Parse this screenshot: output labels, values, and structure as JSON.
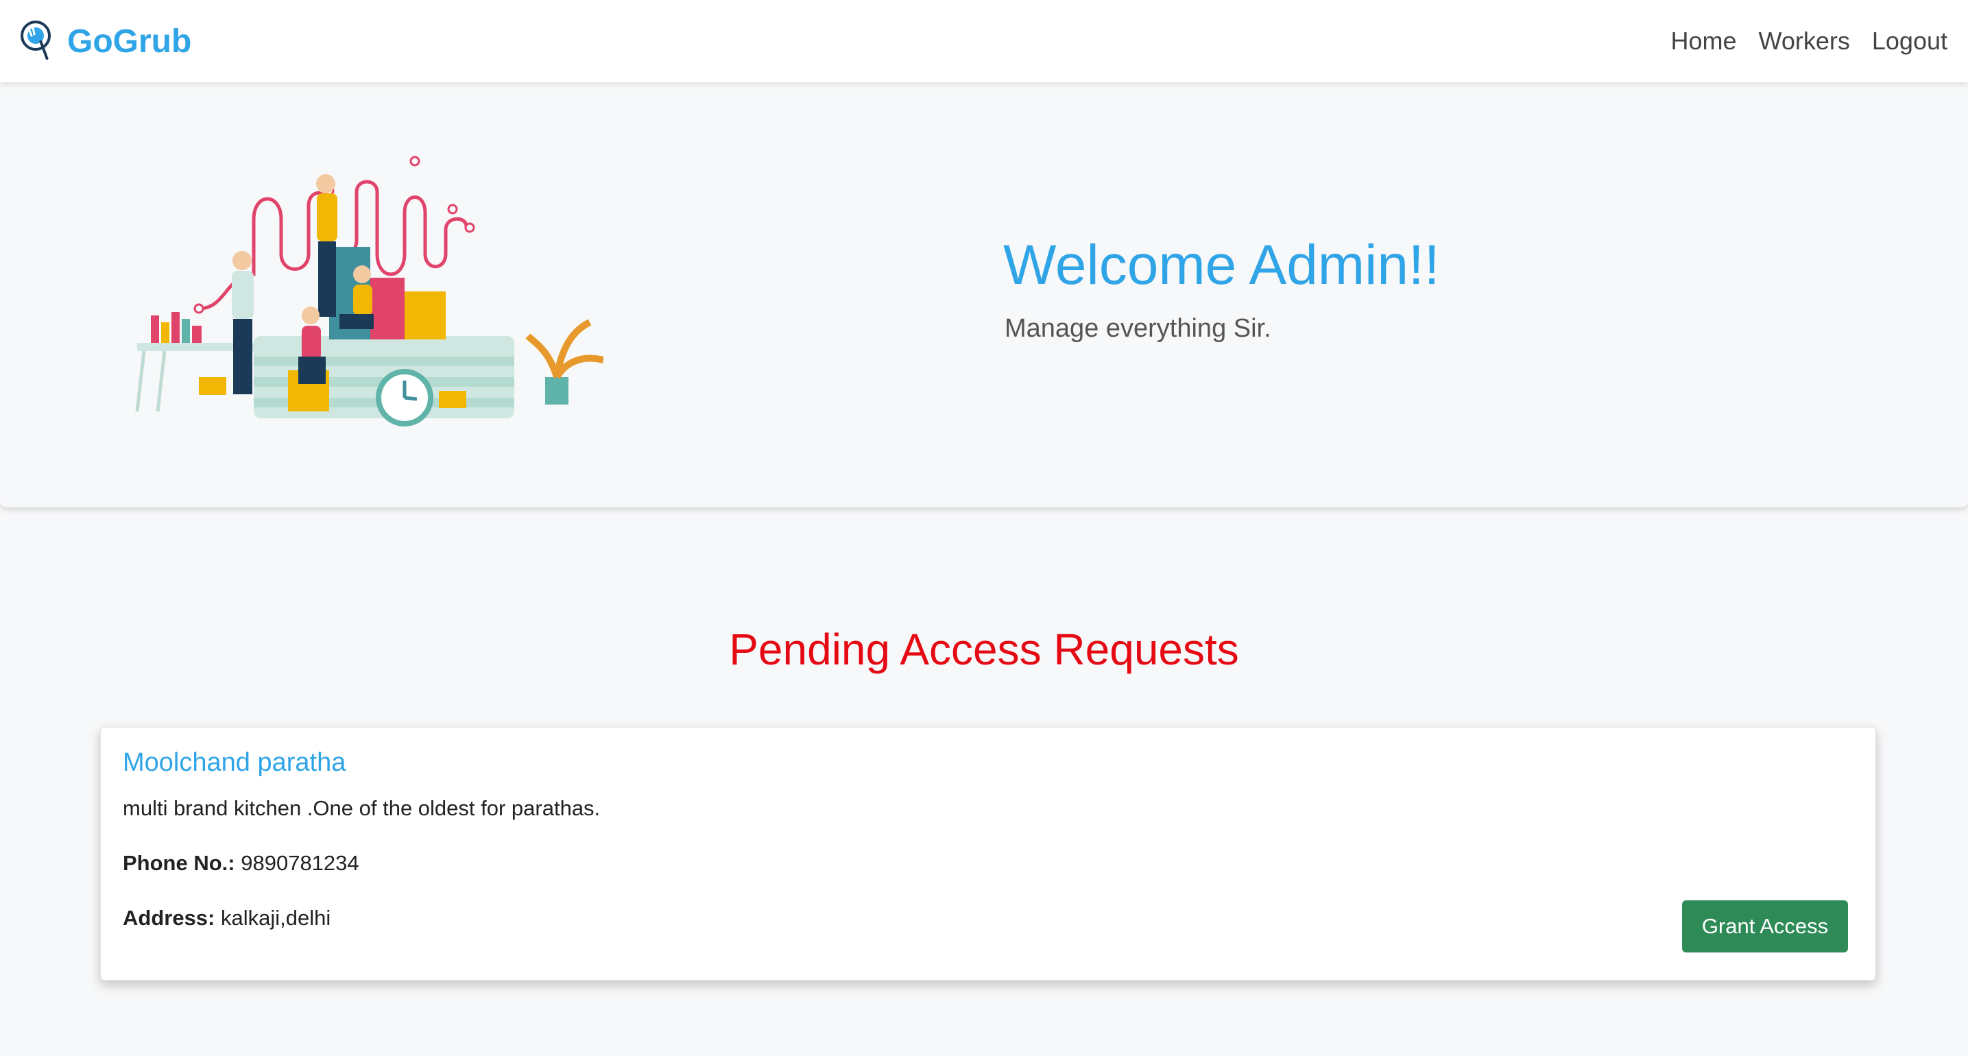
{
  "navbar": {
    "brand": "GoGrub",
    "links": [
      {
        "label": "Home"
      },
      {
        "label": "Workers"
      },
      {
        "label": "Logout"
      }
    ],
    "brand_color": "#2fa4e7"
  },
  "hero": {
    "title": "Welcome Admin!!",
    "subtitle": "Manage everything Sir."
  },
  "pending": {
    "title": "Pending Access Requests",
    "title_color": "#e50914",
    "requests": [
      {
        "name": "Moolchand paratha",
        "description": "multi brand kitchen .One of the oldest for parathas.",
        "phone_label": "Phone No.:",
        "phone": "9890781234",
        "address_label": "Address:",
        "address": "kalkaji,delhi",
        "action_label": "Grant Access",
        "action_color": "#2e8b57"
      }
    ]
  }
}
